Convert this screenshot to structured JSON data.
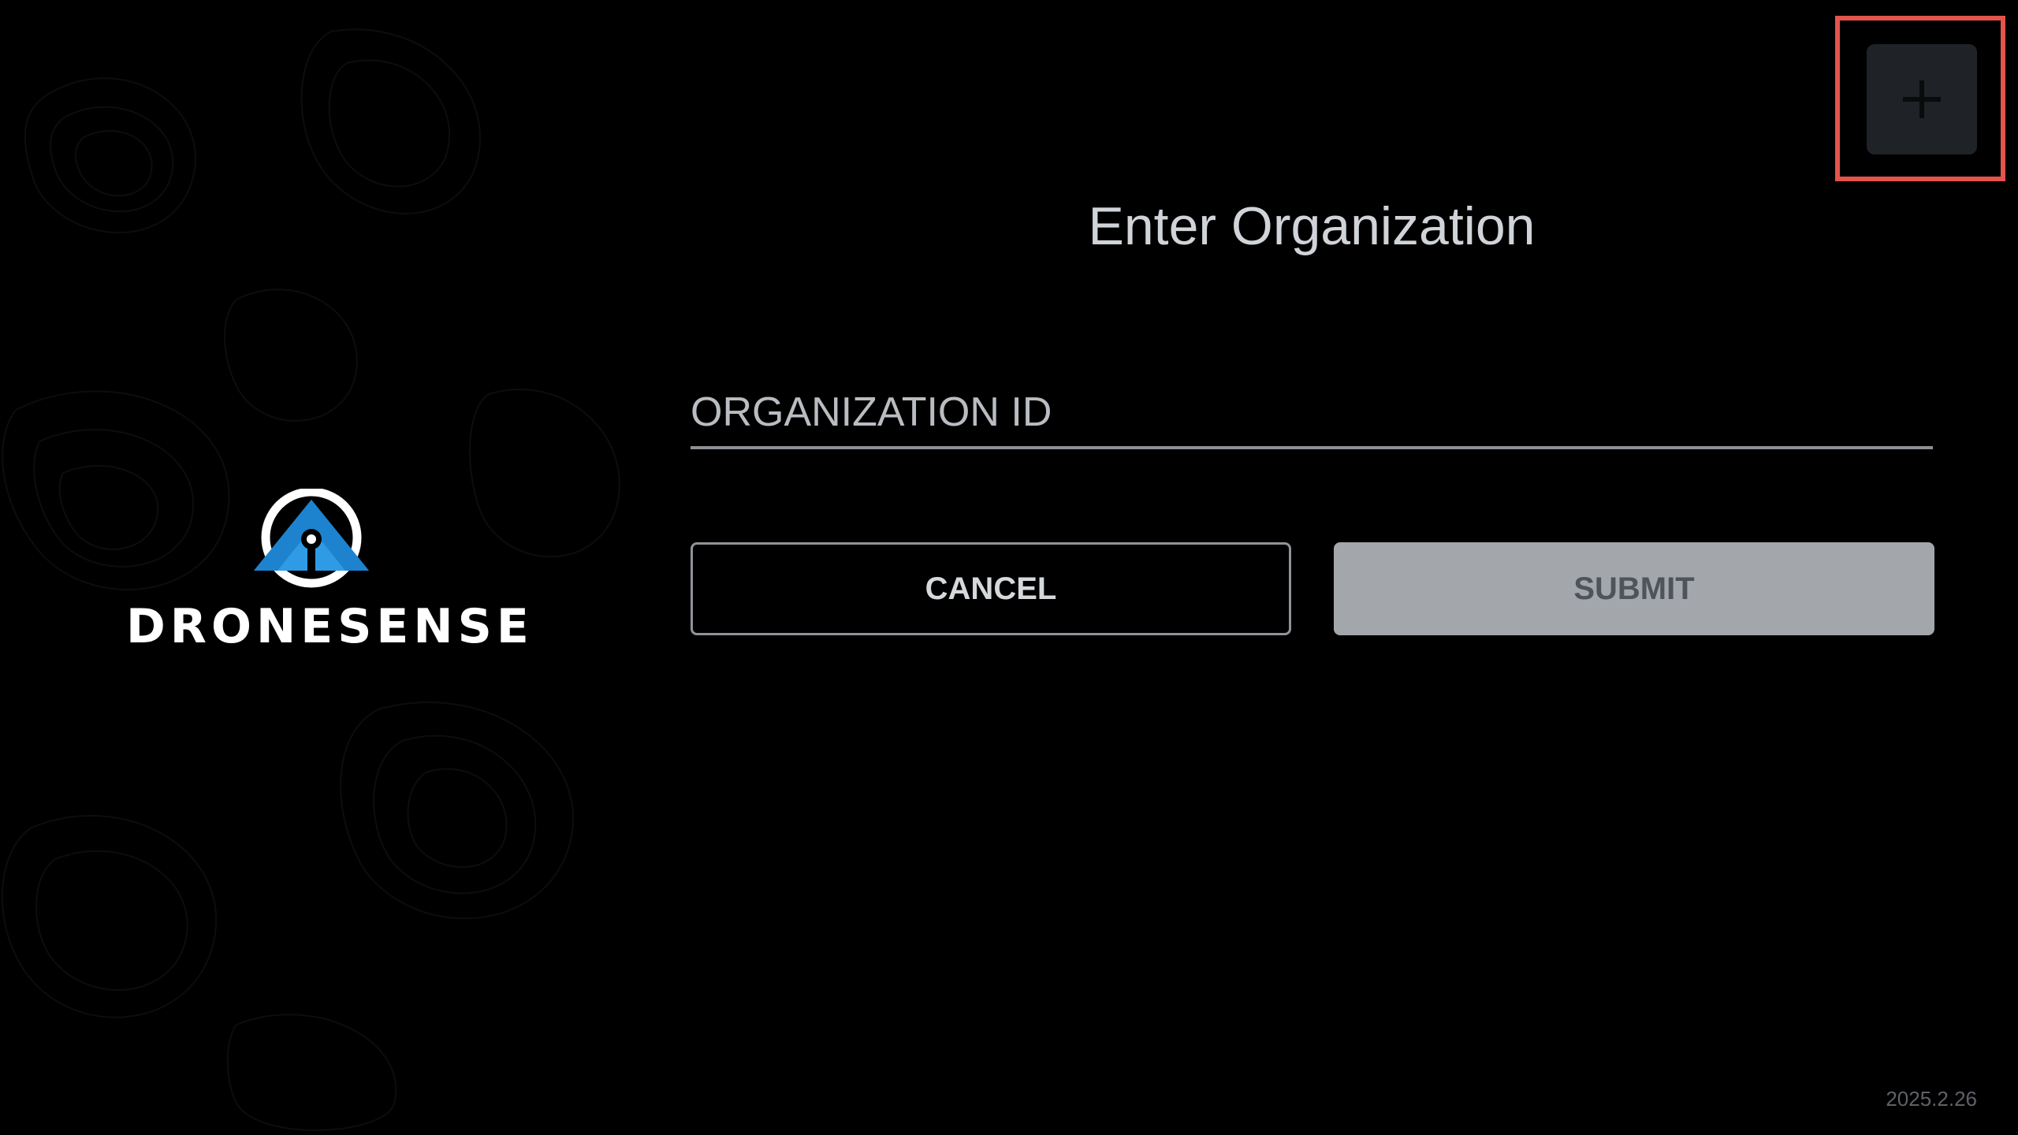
{
  "brand": {
    "wordmark": "DRONESENSE",
    "logo_icon": "dronesense-logo-icon",
    "accent_color": "#2f9be6"
  },
  "page": {
    "title": "Enter Organization"
  },
  "form": {
    "organization_id": {
      "value": "",
      "placeholder": "ORGANIZATION ID"
    },
    "cancel_label": "CANCEL",
    "submit_label": "SUBMIT"
  },
  "toolbar": {
    "add_icon": "plus-icon"
  },
  "footer": {
    "version": "2025.2.26"
  },
  "colors": {
    "background": "#000000",
    "highlight": "#e5544b",
    "submit_disabled": "#a3a7ab"
  }
}
